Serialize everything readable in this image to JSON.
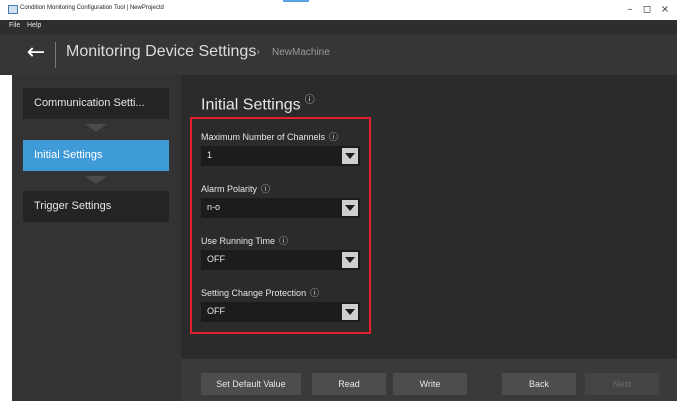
{
  "window": {
    "title": "Condition Monitoring Configuration Tool | NewProjectd",
    "controls": {
      "minimize": "–",
      "maximize": "◻",
      "close": "×"
    }
  },
  "menu": {
    "items": [
      "File",
      "Help"
    ]
  },
  "header": {
    "back_icon": "←",
    "title": "Monitoring Device Settings",
    "separator": "›",
    "subtitle": "NewMachine"
  },
  "sidebar": {
    "steps": [
      {
        "label": "Communication Setti...",
        "state": "done"
      },
      {
        "label": "Initial Settings",
        "state": "active"
      },
      {
        "label": "Trigger Settings",
        "state": "pending"
      }
    ]
  },
  "main": {
    "title": "Initial Settings",
    "info_icon": "ⓘ",
    "fields": [
      {
        "label": "Maximum Number of Channels",
        "value": "1"
      },
      {
        "label": "Alarm Polarity",
        "value": "n-o"
      },
      {
        "label": "Use Running Time",
        "value": "OFF"
      },
      {
        "label": "Setting Change Protection",
        "value": "OFF"
      }
    ]
  },
  "footer": {
    "set_default": "Set Default Value",
    "read": "Read",
    "write": "Write",
    "back": "Back",
    "next": "Next"
  },
  "colors": {
    "accent": "#3f9ad8",
    "highlight": "#e0202c"
  }
}
